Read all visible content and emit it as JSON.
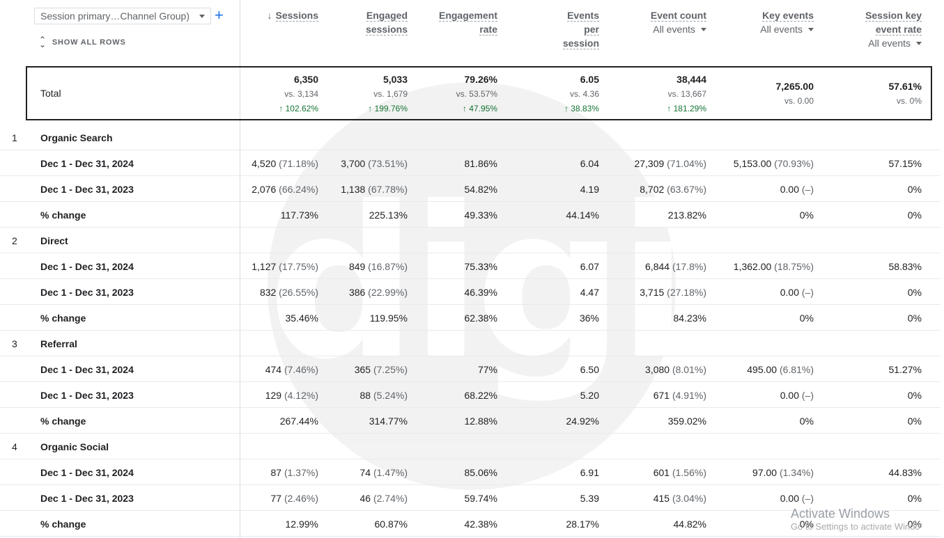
{
  "dimension": {
    "label": "Session primary…Channel Group)",
    "add_label": "+"
  },
  "show_all_rows": "SHOW ALL ROWS",
  "columns": [
    {
      "key": "sessions",
      "lines": [
        "Sessions"
      ],
      "sub": "",
      "sorted": true
    },
    {
      "key": "engaged",
      "lines": [
        "Engaged",
        "sessions"
      ],
      "sub": "",
      "sorted": false
    },
    {
      "key": "eng_rate",
      "lines": [
        "Engagement",
        "rate"
      ],
      "sub": "",
      "sorted": false
    },
    {
      "key": "events_per",
      "lines": [
        "Events",
        "per",
        "session"
      ],
      "sub": "",
      "sorted": false
    },
    {
      "key": "event_count",
      "lines": [
        "Event count"
      ],
      "sub": "All events",
      "sorted": false
    },
    {
      "key": "key_events",
      "lines": [
        "Key events"
      ],
      "sub": "All events",
      "sorted": false
    },
    {
      "key": "key_rate",
      "lines": [
        "Session key",
        "event rate"
      ],
      "sub": "All events",
      "sorted": false
    }
  ],
  "total": {
    "label": "Total",
    "cells": [
      {
        "main": "6,350",
        "vs": "vs. 3,134",
        "chg": "↑ 102.62%"
      },
      {
        "main": "5,033",
        "vs": "vs. 1,679",
        "chg": "↑ 199.76%"
      },
      {
        "main": "79.26%",
        "vs": "vs. 53.57%",
        "chg": "↑ 47.95%"
      },
      {
        "main": "6.05",
        "vs": "vs. 4.36",
        "chg": "↑ 38.83%"
      },
      {
        "main": "38,444",
        "vs": "vs. 13,667",
        "chg": "↑ 181.29%"
      },
      {
        "main": "7,265.00",
        "vs": "vs. 0.00",
        "chg": ""
      },
      {
        "main": "57.61%",
        "vs": "vs. 0%",
        "chg": ""
      }
    ]
  },
  "groups": [
    {
      "index": "1",
      "name": "Organic Search",
      "rows": [
        {
          "label": "Dec 1 - Dec 31, 2024",
          "cells": [
            [
              "4,520",
              " (71.18%)"
            ],
            [
              "3,700",
              " (73.51%)"
            ],
            [
              "81.86%",
              ""
            ],
            [
              "6.04",
              ""
            ],
            [
              "27,309",
              " (71.04%)"
            ],
            [
              "5,153.00",
              " (70.93%)"
            ],
            [
              "57.15%",
              ""
            ]
          ]
        },
        {
          "label": "Dec 1 - Dec 31, 2023",
          "cells": [
            [
              "2,076",
              " (66.24%)"
            ],
            [
              "1,138",
              " (67.78%)"
            ],
            [
              "54.82%",
              ""
            ],
            [
              "4.19",
              ""
            ],
            [
              "8,702",
              " (63.67%)"
            ],
            [
              "0.00",
              " (–)"
            ],
            [
              "0%",
              ""
            ]
          ]
        },
        {
          "label": "% change",
          "cells": [
            [
              "117.73%",
              ""
            ],
            [
              "225.13%",
              ""
            ],
            [
              "49.33%",
              ""
            ],
            [
              "44.14%",
              ""
            ],
            [
              "213.82%",
              ""
            ],
            [
              "0%",
              ""
            ],
            [
              "0%",
              ""
            ]
          ]
        }
      ]
    },
    {
      "index": "2",
      "name": "Direct",
      "rows": [
        {
          "label": "Dec 1 - Dec 31, 2024",
          "cells": [
            [
              "1,127",
              " (17.75%)"
            ],
            [
              "849",
              " (16.87%)"
            ],
            [
              "75.33%",
              ""
            ],
            [
              "6.07",
              ""
            ],
            [
              "6,844",
              " (17.8%)"
            ],
            [
              "1,362.00",
              " (18.75%)"
            ],
            [
              "58.83%",
              ""
            ]
          ]
        },
        {
          "label": "Dec 1 - Dec 31, 2023",
          "cells": [
            [
              "832",
              " (26.55%)"
            ],
            [
              "386",
              " (22.99%)"
            ],
            [
              "46.39%",
              ""
            ],
            [
              "4.47",
              ""
            ],
            [
              "3,715",
              " (27.18%)"
            ],
            [
              "0.00",
              " (–)"
            ],
            [
              "0%",
              ""
            ]
          ]
        },
        {
          "label": "% change",
          "cells": [
            [
              "35.46%",
              ""
            ],
            [
              "119.95%",
              ""
            ],
            [
              "62.38%",
              ""
            ],
            [
              "36%",
              ""
            ],
            [
              "84.23%",
              ""
            ],
            [
              "0%",
              ""
            ],
            [
              "0%",
              ""
            ]
          ]
        }
      ]
    },
    {
      "index": "3",
      "name": "Referral",
      "rows": [
        {
          "label": "Dec 1 - Dec 31, 2024",
          "cells": [
            [
              "474",
              " (7.46%)"
            ],
            [
              "365",
              " (7.25%)"
            ],
            [
              "77%",
              ""
            ],
            [
              "6.50",
              ""
            ],
            [
              "3,080",
              " (8.01%)"
            ],
            [
              "495.00",
              " (6.81%)"
            ],
            [
              "51.27%",
              ""
            ]
          ]
        },
        {
          "label": "Dec 1 - Dec 31, 2023",
          "cells": [
            [
              "129",
              " (4.12%)"
            ],
            [
              "88",
              " (5.24%)"
            ],
            [
              "68.22%",
              ""
            ],
            [
              "5.20",
              ""
            ],
            [
              "671",
              " (4.91%)"
            ],
            [
              "0.00",
              " (–)"
            ],
            [
              "0%",
              ""
            ]
          ]
        },
        {
          "label": "% change",
          "cells": [
            [
              "267.44%",
              ""
            ],
            [
              "314.77%",
              ""
            ],
            [
              "12.88%",
              ""
            ],
            [
              "24.92%",
              ""
            ],
            [
              "359.02%",
              ""
            ],
            [
              "0%",
              ""
            ],
            [
              "0%",
              ""
            ]
          ]
        }
      ]
    },
    {
      "index": "4",
      "name": "Organic Social",
      "rows": [
        {
          "label": "Dec 1 - Dec 31, 2024",
          "cells": [
            [
              "87",
              " (1.37%)"
            ],
            [
              "74",
              " (1.47%)"
            ],
            [
              "85.06%",
              ""
            ],
            [
              "6.91",
              ""
            ],
            [
              "601",
              " (1.56%)"
            ],
            [
              "97.00",
              " (1.34%)"
            ],
            [
              "44.83%",
              ""
            ]
          ]
        },
        {
          "label": "Dec 1 - Dec 31, 2023",
          "cells": [
            [
              "77",
              " (2.46%)"
            ],
            [
              "46",
              " (2.74%)"
            ],
            [
              "59.74%",
              ""
            ],
            [
              "5.39",
              ""
            ],
            [
              "415",
              " (3.04%)"
            ],
            [
              "0.00",
              " (–)"
            ],
            [
              "0%",
              ""
            ]
          ]
        },
        {
          "label": "% change",
          "cells": [
            [
              "12.99%",
              ""
            ],
            [
              "60.87%",
              ""
            ],
            [
              "42.38%",
              ""
            ],
            [
              "28.17%",
              ""
            ],
            [
              "44.82%",
              ""
            ],
            [
              "0%",
              ""
            ],
            [
              "0%",
              ""
            ]
          ]
        }
      ]
    }
  ],
  "watermark": "digi",
  "activate": {
    "title": "Activate Windows",
    "sub": "Go to Settings to activate Windo"
  }
}
